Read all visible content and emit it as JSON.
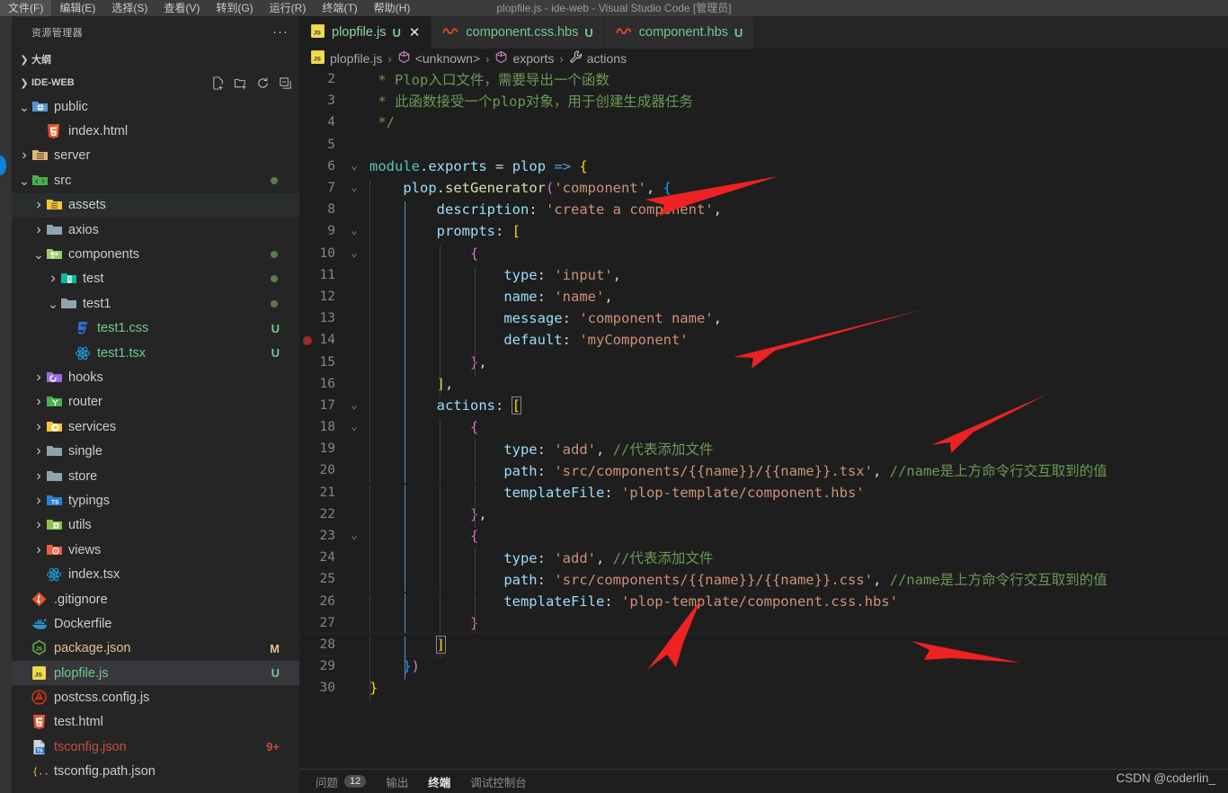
{
  "window": {
    "title": "plopfile.js - ide-web - Visual Studio Code [管理员]",
    "menu": [
      "文件(F)",
      "编辑(E)",
      "选择(S)",
      "查看(V)",
      "转到(G)",
      "运行(R)",
      "终端(T)",
      "帮助(H)"
    ]
  },
  "sidebar": {
    "title": "资源管理器",
    "more_label": "···",
    "outline_label": "大纲",
    "root_label": "IDE-WEB",
    "tree": [
      {
        "label": "public",
        "indent": 1,
        "type": "folder",
        "icon": "folder-public-icon",
        "twisty": "open",
        "badge": "",
        "dot": false,
        "state": ""
      },
      {
        "label": "index.html",
        "indent": 2,
        "type": "file",
        "icon": "html-icon",
        "twisty": "",
        "badge": "",
        "dot": false,
        "state": ""
      },
      {
        "label": "server",
        "indent": 1,
        "type": "folder",
        "icon": "folder-server-icon",
        "twisty": "closed",
        "badge": "",
        "dot": false,
        "state": ""
      },
      {
        "label": "src",
        "indent": 1,
        "type": "folder",
        "icon": "folder-src-icon",
        "twisty": "open",
        "badge": "",
        "dot": true,
        "state": ""
      },
      {
        "label": "assets",
        "indent": 2,
        "type": "folder",
        "icon": "folder-assets-icon",
        "twisty": "closed",
        "badge": "",
        "dot": false,
        "state": "hoverd"
      },
      {
        "label": "axios",
        "indent": 2,
        "type": "folder",
        "icon": "folder-grey-icon",
        "twisty": "closed",
        "badge": "",
        "dot": false,
        "state": ""
      },
      {
        "label": "components",
        "indent": 2,
        "type": "folder",
        "icon": "folder-comp-icon",
        "twisty": "open",
        "badge": "",
        "dot": true,
        "state": ""
      },
      {
        "label": "test",
        "indent": 3,
        "type": "folder",
        "icon": "folder-test-icon",
        "twisty": "closed",
        "badge": "",
        "dot": true,
        "state": ""
      },
      {
        "label": "test1",
        "indent": 3,
        "type": "folder",
        "icon": "folder-grey-icon",
        "twisty": "open",
        "badge": "",
        "dot": true,
        "state": ""
      },
      {
        "label": "test1.css",
        "indent": 4,
        "type": "file",
        "icon": "css-icon",
        "twisty": "",
        "badge": "U",
        "dot": false,
        "state": ""
      },
      {
        "label": "test1.tsx",
        "indent": 4,
        "type": "file",
        "icon": "react-icon",
        "twisty": "",
        "badge": "U",
        "dot": false,
        "state": ""
      },
      {
        "label": "hooks",
        "indent": 2,
        "type": "folder",
        "icon": "folder-hooks-icon",
        "twisty": "closed",
        "badge": "",
        "dot": false,
        "state": ""
      },
      {
        "label": "router",
        "indent": 2,
        "type": "folder",
        "icon": "folder-router-icon",
        "twisty": "closed",
        "badge": "",
        "dot": false,
        "state": ""
      },
      {
        "label": "services",
        "indent": 2,
        "type": "folder",
        "icon": "folder-services-icon",
        "twisty": "closed",
        "badge": "",
        "dot": false,
        "state": ""
      },
      {
        "label": "single",
        "indent": 2,
        "type": "folder",
        "icon": "folder-grey-icon",
        "twisty": "closed",
        "badge": "",
        "dot": false,
        "state": ""
      },
      {
        "label": "store",
        "indent": 2,
        "type": "folder",
        "icon": "folder-grey-icon",
        "twisty": "closed",
        "badge": "",
        "dot": false,
        "state": ""
      },
      {
        "label": "typings",
        "indent": 2,
        "type": "folder",
        "icon": "folder-ts-icon",
        "twisty": "closed",
        "badge": "",
        "dot": false,
        "state": ""
      },
      {
        "label": "utils",
        "indent": 2,
        "type": "folder",
        "icon": "folder-utils-icon",
        "twisty": "closed",
        "badge": "",
        "dot": false,
        "state": ""
      },
      {
        "label": "views",
        "indent": 2,
        "type": "folder",
        "icon": "folder-views-icon",
        "twisty": "closed",
        "badge": "",
        "dot": false,
        "state": ""
      },
      {
        "label": "index.tsx",
        "indent": 2,
        "type": "file",
        "icon": "react-icon",
        "twisty": "",
        "badge": "",
        "dot": false,
        "state": ""
      },
      {
        "label": ".gitignore",
        "indent": 1,
        "type": "file",
        "icon": "git-icon",
        "twisty": "",
        "badge": "",
        "dot": false,
        "state": ""
      },
      {
        "label": "Dockerfile",
        "indent": 1,
        "type": "file",
        "icon": "docker-icon",
        "twisty": "",
        "badge": "",
        "dot": false,
        "state": ""
      },
      {
        "label": "package.json",
        "indent": 1,
        "type": "file",
        "icon": "node-icon",
        "twisty": "",
        "badge": "M",
        "dot": false,
        "state": ""
      },
      {
        "label": "plopfile.js",
        "indent": 1,
        "type": "file",
        "icon": "js-icon",
        "twisty": "",
        "badge": "U",
        "dot": false,
        "state": "selected"
      },
      {
        "label": "postcss.config.js",
        "indent": 1,
        "type": "file",
        "icon": "postcss-icon",
        "twisty": "",
        "badge": "",
        "dot": false,
        "state": ""
      },
      {
        "label": "test.html",
        "indent": 1,
        "type": "file",
        "icon": "html-icon",
        "twisty": "",
        "badge": "",
        "dot": false,
        "state": ""
      },
      {
        "label": "tsconfig.json",
        "indent": 1,
        "type": "file",
        "icon": "tsconfig-icon",
        "twisty": "",
        "badge": "9+",
        "dot": false,
        "state": ""
      },
      {
        "label": "tsconfig.path.json",
        "indent": 1,
        "type": "file",
        "icon": "json-icon",
        "twisty": "",
        "badge": "",
        "dot": false,
        "state": ""
      }
    ]
  },
  "editor": {
    "tabs": [
      {
        "label": "plopfile.js",
        "icon": "js-icon",
        "badge": "U",
        "active": true,
        "close": "✕"
      },
      {
        "label": "component.css.hbs",
        "icon": "hbs-icon",
        "badge": "U",
        "active": false,
        "close": ""
      },
      {
        "label": "component.hbs",
        "icon": "hbs-icon",
        "badge": "U",
        "active": false,
        "close": ""
      }
    ],
    "breadcrumb": [
      {
        "label": "plopfile.js",
        "icon": "js-icon"
      },
      {
        "label": "<unknown>",
        "icon": "symbol-icon"
      },
      {
        "label": "exports",
        "icon": "symbol-icon"
      },
      {
        "label": "actions",
        "icon": "wrench-icon"
      }
    ]
  },
  "code": {
    "first_visible_line": 2,
    "breakpoint_line": 14,
    "current_line": 28,
    "lines": [
      {
        "n": 2,
        "fold": "",
        "html": "<span class='t-cmt'> * Plop入口文件，需要导出一个函数</span>"
      },
      {
        "n": 3,
        "fold": "",
        "html": "<span class='t-cmt'> * 此函数接受一个plop对象，用于创建生成器任务</span>"
      },
      {
        "n": 4,
        "fold": "",
        "html": "<span class='t-cmt'> */</span>"
      },
      {
        "n": 5,
        "fold": "",
        "html": ""
      },
      {
        "n": 6,
        "fold": "v",
        "html": "<span class='t-obj'>module</span><span class='t-plain'>.</span><span class='t-var'>exports</span> <span class='t-plain'>=</span> <span class='t-var'>plop</span> <span class='t-arrow'>=&gt;</span> <span class='t-y'>{</span>"
      },
      {
        "n": 7,
        "fold": "v",
        "html": "    <span class='t-var'>plop</span><span class='t-plain'>.</span><span class='t-fn'>setGenerator</span><span class='t-p'>(</span><span class='t-str'>'component'</span><span class='t-plain'>,</span> <span class='t-b'>{</span>"
      },
      {
        "n": 8,
        "fold": "",
        "html": "        <span class='t-var'>description</span><span class='t-plain'>:</span> <span class='t-str'>'create a component'</span><span class='t-plain'>,</span>"
      },
      {
        "n": 9,
        "fold": "v",
        "html": "        <span class='t-var'>prompts</span><span class='t-plain'>:</span> <span class='t-y'>[</span>"
      },
      {
        "n": 10,
        "fold": "v",
        "html": "            <span class='t-p'>{</span>"
      },
      {
        "n": 11,
        "fold": "",
        "html": "                <span class='t-var'>type</span><span class='t-plain'>:</span> <span class='t-str'>'input'</span><span class='t-plain'>,</span>"
      },
      {
        "n": 12,
        "fold": "",
        "html": "                <span class='t-var'>name</span><span class='t-plain'>:</span> <span class='t-str'>'name'</span><span class='t-plain'>,</span>"
      },
      {
        "n": 13,
        "fold": "",
        "html": "                <span class='t-var'>message</span><span class='t-plain'>:</span> <span class='t-str'>'component name'</span><span class='t-plain'>,</span>"
      },
      {
        "n": 14,
        "fold": "",
        "html": "                <span class='t-var'>default</span><span class='t-plain'>:</span> <span class='t-str'>'myComponent'</span>"
      },
      {
        "n": 15,
        "fold": "",
        "html": "            <span class='t-p'>}</span><span class='t-plain'>,</span>"
      },
      {
        "n": 16,
        "fold": "",
        "html": "        <span class='t-y'>]</span><span class='t-plain'>,</span>"
      },
      {
        "n": 17,
        "fold": "v",
        "html": "        <span class='t-var'>actions</span><span class='t-plain'>:</span> <span class='t-y bracket-box'>[</span>"
      },
      {
        "n": 18,
        "fold": "v",
        "html": "            <span class='t-p'>{</span>"
      },
      {
        "n": 19,
        "fold": "",
        "html": "                <span class='t-var'>type</span><span class='t-plain'>:</span> <span class='t-str'>'add'</span><span class='t-plain'>,</span> <span class='t-cmt'>//代表添加文件</span>"
      },
      {
        "n": 20,
        "fold": "",
        "html": "                <span class='t-var'>path</span><span class='t-plain'>:</span> <span class='t-str'>'src/components/{{name}}/{{name}}.tsx'</span><span class='t-plain'>,</span> <span class='t-cmt'>//name是上方命令行交互取到的值</span>"
      },
      {
        "n": 21,
        "fold": "",
        "html": "                <span class='t-var'>templateFile</span><span class='t-plain'>:</span> <span class='t-str'>'plop-template/component.hbs'</span>"
      },
      {
        "n": 22,
        "fold": "",
        "html": "            <span class='t-p'>}</span><span class='t-plain'>,</span>"
      },
      {
        "n": 23,
        "fold": "v",
        "html": "            <span class='t-p'>{</span>"
      },
      {
        "n": 24,
        "fold": "",
        "html": "                <span class='t-var'>type</span><span class='t-plain'>:</span> <span class='t-str'>'add'</span><span class='t-plain'>,</span> <span class='t-cmt'>//代表添加文件</span>"
      },
      {
        "n": 25,
        "fold": "",
        "html": "                <span class='t-var'>path</span><span class='t-plain'>:</span> <span class='t-str'>'src/components/{{name}}/{{name}}.css'</span><span class='t-plain'>,</span> <span class='t-cmt'>//name是上方命令行交互取到的值</span>"
      },
      {
        "n": 26,
        "fold": "",
        "html": "                <span class='t-var'>templateFile</span><span class='t-plain'>:</span> <span class='t-str'>'plop-template/component.css.hbs'</span>"
      },
      {
        "n": 27,
        "fold": "",
        "html": "            <span class='t-p'>}</span>"
      },
      {
        "n": 28,
        "fold": "",
        "html": "        <span class='t-y bracket-box'>]</span>"
      },
      {
        "n": 29,
        "fold": "",
        "html": "    <span class='t-b'>}</span><span class='t-p'>)</span>"
      },
      {
        "n": 30,
        "fold": "",
        "html": "<span class='t-y'>}</span>"
      }
    ]
  },
  "panel": {
    "tabs": [
      {
        "label": "问题",
        "count": "12",
        "active": false
      },
      {
        "label": "输出",
        "count": "",
        "active": false
      },
      {
        "label": "终端",
        "count": "",
        "active": true
      },
      {
        "label": "调试控制台",
        "count": "",
        "active": false
      }
    ]
  },
  "watermark": "CSDN @coderlin_",
  "colors": {
    "accent_red": "#ee2222",
    "badge_modified": "#e2c08d",
    "badge_untracked": "#73c991",
    "badge_error": "#c74e39",
    "editor_bg": "#1e1e1e",
    "sidebar_bg": "#252526",
    "selected_row": "#37373d"
  }
}
